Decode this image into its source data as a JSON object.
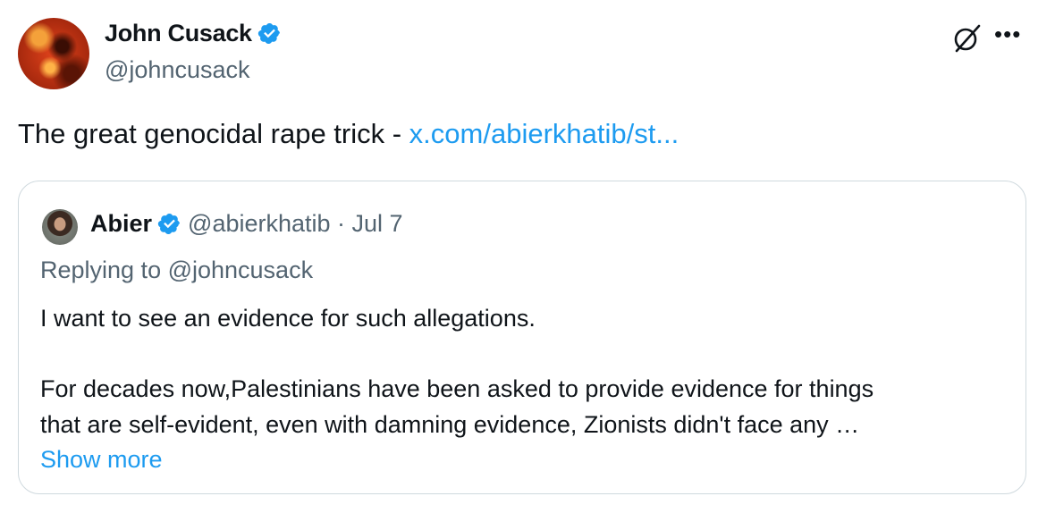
{
  "tweet": {
    "author": {
      "name": "John Cusack",
      "handle": "@johncusack",
      "verified": true,
      "avatar_icon": "avatar"
    },
    "text": "The great genocidal rape trick - ",
    "link_text": "x.com/abierkhatib/st...",
    "actions": {
      "grok_icon": "grok-icon",
      "more_icon": "more-icon"
    }
  },
  "quote": {
    "author": {
      "name": "Abier",
      "handle": "@abierkhatib",
      "verified": true
    },
    "separator": " · ",
    "date": "Jul 7",
    "replying_to": "Replying to @johncusack",
    "body": [
      "I want to see an evidence for such allegations.",
      "For decades now,Palestinians have been asked to provide evidence for things",
      "that are self-evident, even with damning evidence, Zionists didn't face any  …"
    ],
    "show_more": "Show more"
  },
  "colors": {
    "accent": "#1d9bf0",
    "text": "#0f1419",
    "muted": "#536471",
    "border": "#cfd9de"
  }
}
